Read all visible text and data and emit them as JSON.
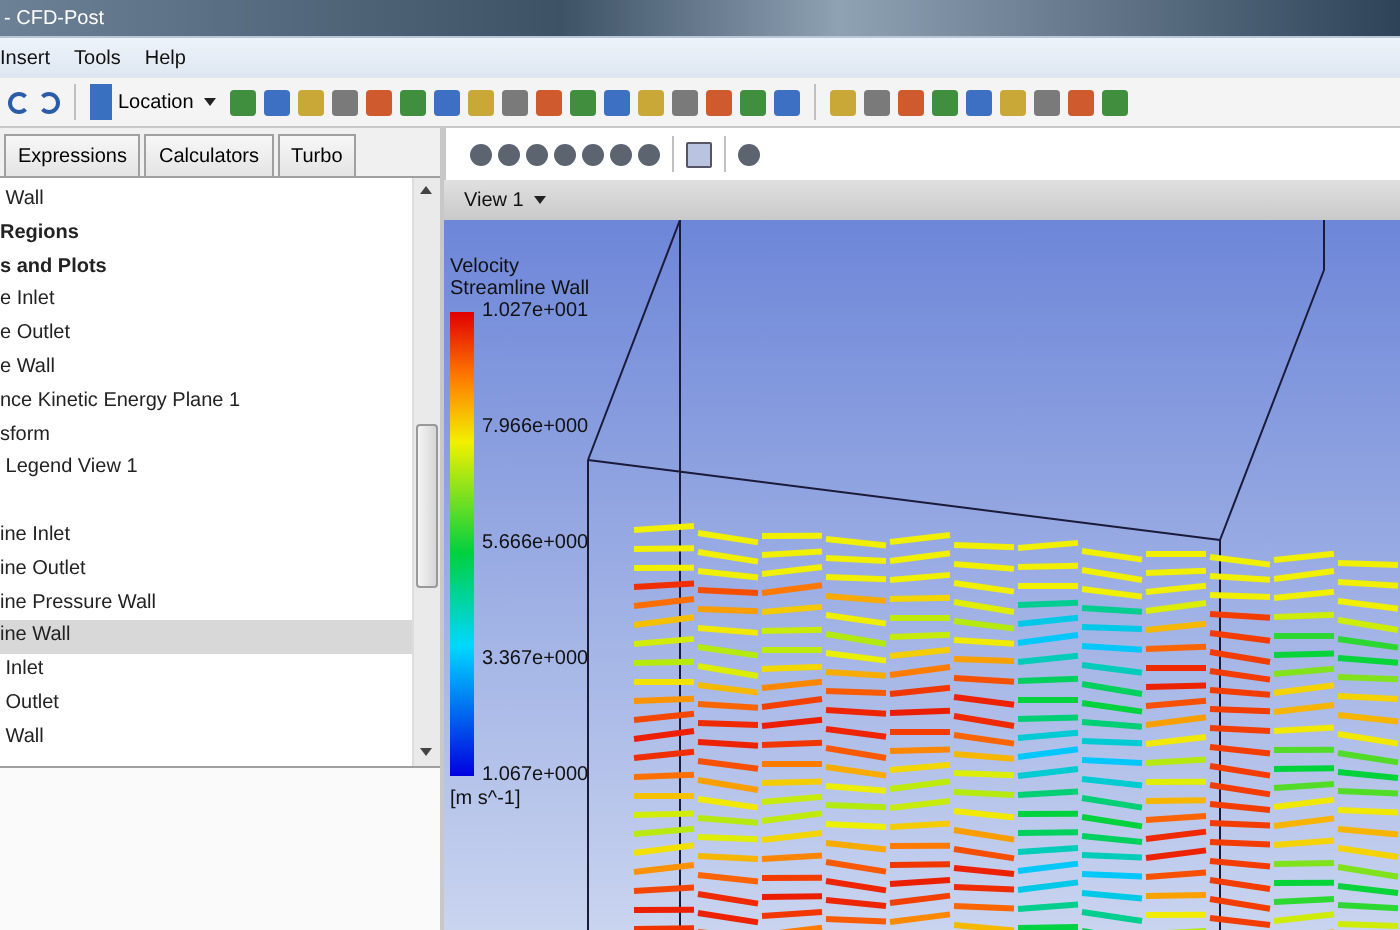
{
  "window": {
    "title": "- CFD-Post"
  },
  "menu": [
    "Insert",
    "Tools",
    "Help"
  ],
  "toolbar": {
    "location_button": "Location"
  },
  "tabs": [
    {
      "label": "Expressions",
      "selected": false
    },
    {
      "label": "Calculators",
      "selected": false
    },
    {
      "label": "Turbo",
      "selected": false
    }
  ],
  "tree": [
    {
      "label": " Wall",
      "kind": "item",
      "selected": false
    },
    {
      "label": "Regions",
      "kind": "group",
      "selected": false
    },
    {
      "label": "s and Plots",
      "kind": "group",
      "selected": false
    },
    {
      "label": "e Inlet",
      "kind": "item",
      "selected": false
    },
    {
      "label": "e Outlet",
      "kind": "item",
      "selected": false
    },
    {
      "label": "e Wall",
      "kind": "item",
      "selected": false
    },
    {
      "label": "nce Kinetic Energy Plane 1",
      "kind": "item",
      "selected": false
    },
    {
      "label": "sform",
      "kind": "item",
      "selected": false
    },
    {
      "label": " Legend View 1",
      "kind": "item",
      "selected": false
    },
    {
      "kind": "blank"
    },
    {
      "label": "ine Inlet",
      "kind": "item",
      "selected": false
    },
    {
      "label": "ine Outlet",
      "kind": "item",
      "selected": false
    },
    {
      "label": "ine Pressure Wall",
      "kind": "item",
      "selected": false
    },
    {
      "label": "ine Wall",
      "kind": "item",
      "selected": true
    },
    {
      "label": " Inlet",
      "kind": "item",
      "selected": false
    },
    {
      "label": " Outlet",
      "kind": "item",
      "selected": false
    },
    {
      "label": " Wall",
      "kind": "item",
      "selected": false
    }
  ],
  "viewer": {
    "view_menu": "View 1",
    "legend": {
      "title": "Velocity",
      "subtitle": "Streamline Wall",
      "ticks": [
        "1.027e+001",
        "7.966e+000",
        "5.666e+000",
        "3.367e+000",
        "1.067e+000"
      ],
      "unit": "[m s^-1]"
    }
  }
}
